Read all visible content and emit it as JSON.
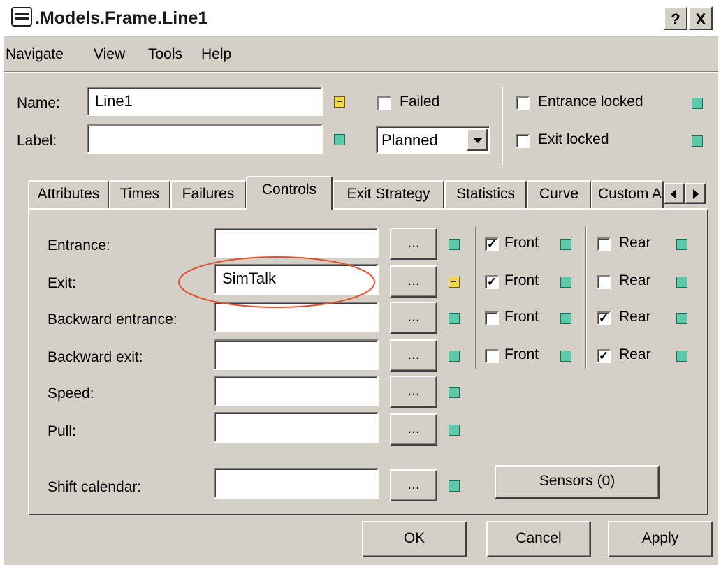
{
  "window": {
    "title": ".Models.Frame.Line1",
    "help_btn": "?",
    "close_btn": "X"
  },
  "menu": [
    "Navigate",
    "View",
    "Tools",
    "Help"
  ],
  "header": {
    "name_label": "Name:",
    "name_value": "Line1",
    "label_label": "Label:",
    "label_value": "",
    "failed_label": "Failed",
    "planned_value": "Planned",
    "entrance_locked_label": "Entrance locked",
    "exit_locked_label": "Exit locked"
  },
  "tabs": [
    "Attributes",
    "Times",
    "Failures",
    "Controls",
    "Exit Strategy",
    "Statistics",
    "Curve",
    "Custom A"
  ],
  "active_tab": "Controls",
  "controls": {
    "rows": [
      {
        "label": "Entrance:",
        "value": "",
        "front": true,
        "rear": false
      },
      {
        "label": "Exit:",
        "value": "SimTalk",
        "front": true,
        "rear": false
      },
      {
        "label": "Backward entrance:",
        "value": "",
        "front": false,
        "rear": true
      },
      {
        "label": "Backward exit:",
        "value": "",
        "front": false,
        "rear": true
      },
      {
        "label": "Speed:",
        "value": ""
      },
      {
        "label": "Pull:",
        "value": ""
      },
      {
        "label": "Shift calendar:",
        "value": ""
      }
    ],
    "dots": "...",
    "front_label": "Front",
    "rear_label": "Rear",
    "sensors_label": "Sensors (0)"
  },
  "buttons": {
    "ok": "OK",
    "cancel": "Cancel",
    "apply": "Apply"
  },
  "colors": {
    "indicator": "#5ec9a8",
    "indicator_modified": "#f3d64a",
    "annotation": "#e2512d"
  }
}
